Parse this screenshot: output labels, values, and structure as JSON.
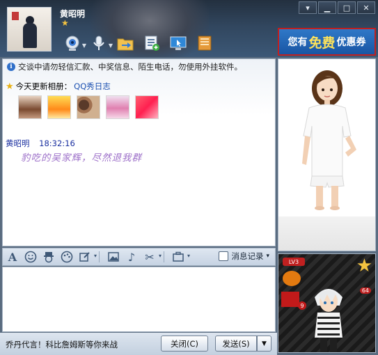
{
  "header": {
    "username": "黄昭明",
    "coupon": {
      "part1": "您有",
      "part2": "免费",
      "part3": "优惠券"
    }
  },
  "window_controls": [
    "menu",
    "minimize",
    "maximize",
    "close"
  ],
  "chat": {
    "notice": "交谈中请勿轻信汇款、中奖信息、陌生电话，勿使用外挂软件。",
    "album_label": "今天更新相册：",
    "album_link": "QQ秀日志",
    "message": {
      "sender": "黄昭明",
      "time": "18:32:16",
      "text": "豹吃的吴家辉，尽然退我群"
    }
  },
  "format_toolbar": {
    "history_label": "消息记录"
  },
  "bottom_bar": {
    "ad_text": "乔丹代言！科比詹姆斯等你来战",
    "close_label": "关闭(C)",
    "send_label": "发送(S)"
  },
  "pet_panel": {
    "level": "LV3",
    "gift_count": "9",
    "badge": "64"
  },
  "colors": {
    "header_dark": "#23303f",
    "link_blue": "#1a4fb0",
    "message_purple": "#9d70c9",
    "coupon_blue": "#1855a3"
  }
}
